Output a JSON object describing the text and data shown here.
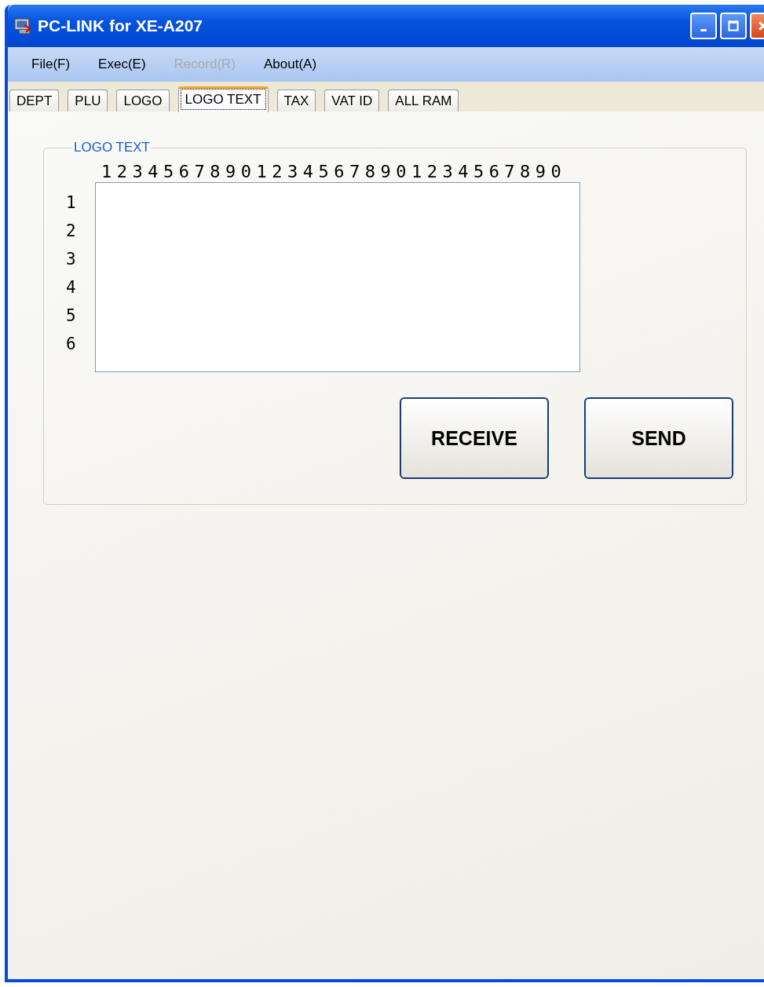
{
  "window": {
    "title": "PC-LINK for XE-A207"
  },
  "menu": [
    {
      "label": "File(F)",
      "disabled": false
    },
    {
      "label": "Exec(E)",
      "disabled": false
    },
    {
      "label": "Record(R)",
      "disabled": true
    },
    {
      "label": "About(A)",
      "disabled": false
    }
  ],
  "tabs": [
    {
      "label": "DEPT",
      "selected": false
    },
    {
      "label": "PLU",
      "selected": false
    },
    {
      "label": "LOGO",
      "selected": false
    },
    {
      "label": "LOGO TEXT",
      "selected": true
    },
    {
      "label": "TAX",
      "selected": false
    },
    {
      "label": "VAT ID",
      "selected": false
    },
    {
      "label": "ALL RAM",
      "selected": false
    }
  ],
  "group": {
    "title": "LOGO TEXT",
    "ruler": "123456789012345678901234567890",
    "line_numbers": [
      "1",
      "2",
      "3",
      "4",
      "5",
      "6"
    ]
  },
  "buttons": [
    "RECEIVE",
    "SEND"
  ]
}
